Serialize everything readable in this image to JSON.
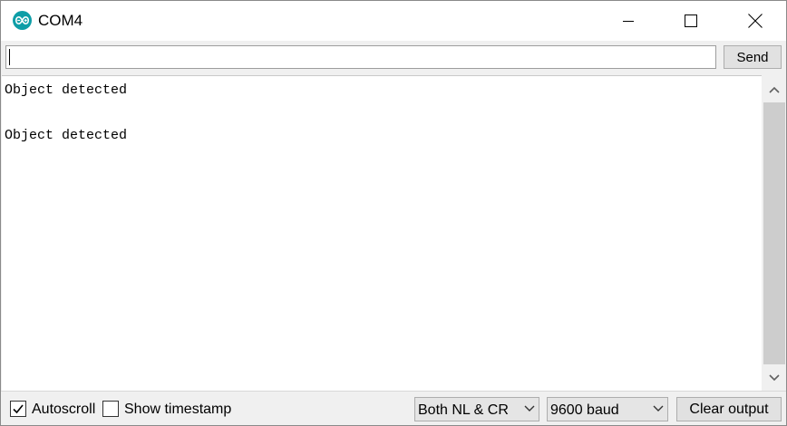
{
  "window": {
    "title": "COM4",
    "app_icon": "arduino-infinity-icon",
    "accent_color": "#0e9ea7"
  },
  "send_row": {
    "input_value": "",
    "send_label": "Send"
  },
  "output": {
    "lines": [
      "Object detected",
      "",
      "Object detected"
    ]
  },
  "footer": {
    "autoscroll_label": "Autoscroll",
    "autoscroll_checked": true,
    "timestamp_label": "Show timestamp",
    "timestamp_checked": false,
    "line_ending": "Both NL & CR",
    "baud_rate": "9600 baud",
    "clear_label": "Clear output"
  }
}
